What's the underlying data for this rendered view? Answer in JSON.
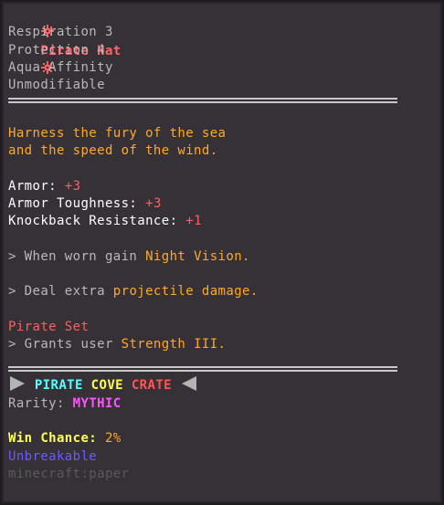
{
  "tooltip": {
    "title": "Pirate Hat",
    "enchantments": [
      "Respiration 3",
      "Protection 4",
      "Aqua Affinity",
      "Unmodifiable"
    ],
    "lore": [
      "Harness the fury of the sea",
      "and the speed of the wind."
    ],
    "stats": [
      {
        "label": "Armor:",
        "value": "+3"
      },
      {
        "label": "Armor Toughness:",
        "value": "+3"
      },
      {
        "label": "Knockback Resistance:",
        "value": "+1"
      }
    ],
    "abilities": [
      {
        "prefix": "> When worn gain ",
        "highlight": "Night Vision."
      },
      {
        "prefix": "> Deal extra ",
        "highlight": "projectile damage."
      }
    ],
    "set": {
      "name": "Pirate Set",
      "bonus_prefix": "> Grants user ",
      "bonus_highlight": "Strength III."
    },
    "crate": {
      "word1": "PIRATE",
      "word2": "COVE",
      "word3": "CRATE"
    },
    "rarity": {
      "label": "Rarity:",
      "value": "MYTHIC"
    },
    "win_chance": {
      "label": "Win Chance:",
      "value": "2%"
    },
    "unbreakable": "Unbreakable",
    "item_id": "minecraft:paper"
  },
  "colors": {
    "background": "#363037",
    "title": "#ff6666",
    "accent": "#ffaa22",
    "rarity": "#ff55ff",
    "unbreakable": "#6a5cff"
  },
  "icons": [
    "flower-icon",
    "play-icon",
    "back-icon"
  ]
}
